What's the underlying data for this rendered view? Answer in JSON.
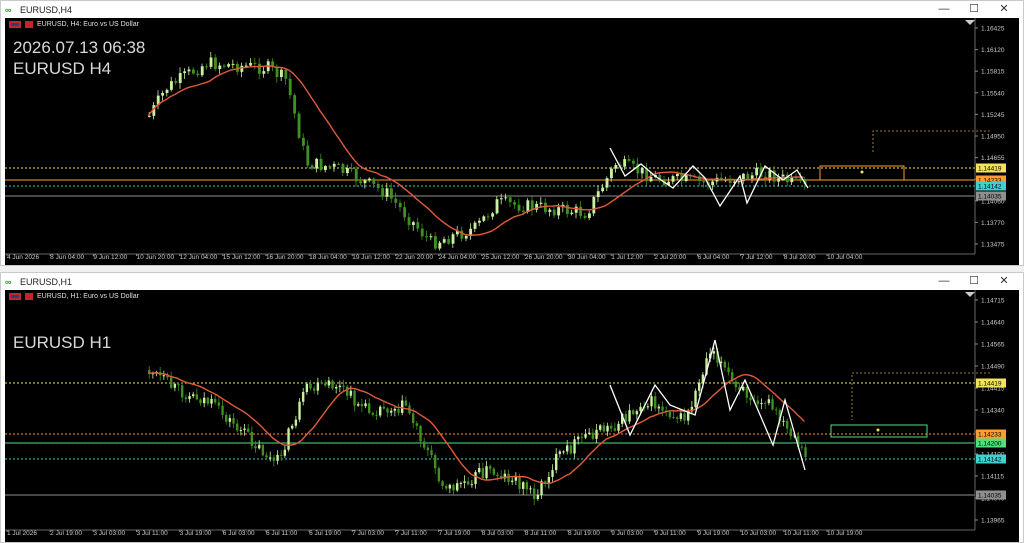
{
  "windows": [
    {
      "id": "h4",
      "title": "EURUSD,H4",
      "header_text": "EURUSD, H4:  Euro vs US Dollar",
      "datetime": "2026.07.13 06:38",
      "symbol_tf": "EURUSD H4",
      "price_ticks": [
        "1.16425",
        "1.16120",
        "1.15815",
        "1.15540",
        "1.15245",
        "1.14950",
        "1.14655",
        "1.14350",
        "1.14060",
        "1.13770",
        "1.13475"
      ],
      "price_labels": [
        {
          "text": "1.14419",
          "color": "#f2e35a"
        },
        {
          "text": "1.14233",
          "color": "#ff9d2e"
        },
        {
          "text": "1.14142",
          "color": "#3fd0d0"
        },
        {
          "text": "1.14035",
          "color": "#8f8f8f"
        }
      ],
      "time_ticks": [
        "4 Jun 2026",
        "8 Jun 04:00",
        "9 Jun 12:00",
        "10 Jun 20:00",
        "12 Jun 04:00",
        "15 Jun 12:00",
        "16 Jun 20:00",
        "18 Jun 04:00",
        "19 Jun 12:00",
        "22 Jun 20:00",
        "24 Jun 04:00",
        "25 Jun 12:00",
        "26 Jun 20:00",
        "30 Jun 04:00",
        "1 Jul 12:00",
        "2 Jul 20:00",
        "6 Jul 04:00",
        "7 Jul 12:00",
        "8 Jul 20:00",
        "10 Jul 04:00"
      ]
    },
    {
      "id": "h1",
      "title": "EURUSD,H1",
      "header_text": "EURUSD, H1:  Euro vs US Dollar",
      "symbol_tf": "EURUSD H1",
      "price_ticks": [
        "1.14715",
        "1.14640",
        "1.14565",
        "1.14490",
        "1.14415",
        "1.14340",
        "1.14265",
        "1.14190",
        "1.14115",
        "1.14040",
        "1.13965"
      ],
      "price_labels": [
        {
          "text": "1.14419",
          "color": "#f2e35a"
        },
        {
          "text": "1.14233",
          "color": "#ff9d2e"
        },
        {
          "text": "1.14200",
          "color": "#4fe07a"
        },
        {
          "text": "1.14142",
          "color": "#3fd0d0"
        },
        {
          "text": "1.14035",
          "color": "#8f8f8f"
        }
      ],
      "time_ticks": [
        "1 Jul 2026",
        "2 Jul 19:00",
        "3 Jul 03:00",
        "3 Jul 11:00",
        "3 Jul 19:00",
        "6 Jul 03:00",
        "6 Jul 11:00",
        "6 Jul 19:00",
        "7 Jul 03:00",
        "7 Jul 11:00",
        "7 Jul 19:00",
        "8 Jul 03:00",
        "8 Jul 11:00",
        "8 Jul 19:00",
        "9 Jul 03:00",
        "9 Jul 11:00",
        "9 Jul 19:00",
        "10 Jul 03:00",
        "10 Jul 11:00",
        "10 Jul 19:00"
      ]
    }
  ],
  "window_controls": {
    "minimize": "—",
    "maximize": "☐",
    "close": "✕"
  },
  "colors": {
    "background": "#000000",
    "bull": "#c8f0a0",
    "bear": "#3f8f22",
    "ma": "#e25a3a",
    "zigzag": "#ffffff"
  }
}
